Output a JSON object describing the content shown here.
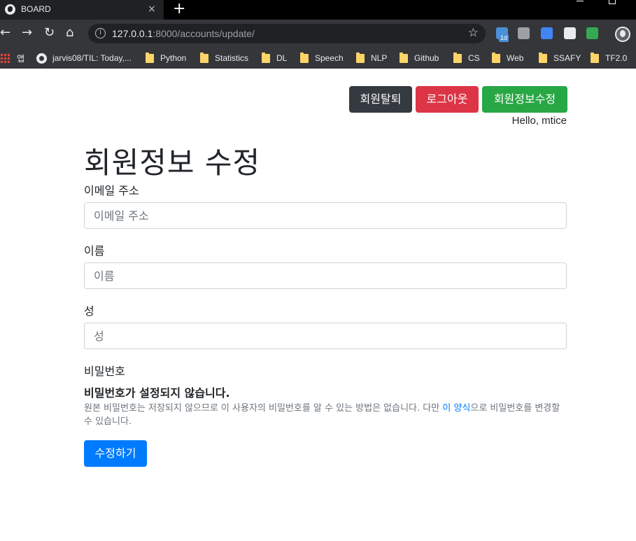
{
  "browser": {
    "tab_title": "BOARD",
    "tab_close": "×",
    "new_tab": "+",
    "url_host": "127.0.0.1",
    "url_path": ":8000/accounts/update/",
    "bookmarks": [
      {
        "label": "앱",
        "icon": "apps-icon"
      },
      {
        "label": "jarvis08/TIL: Today,...",
        "icon": "github-icon"
      },
      {
        "label": "Python",
        "icon": "folder-icon"
      },
      {
        "label": "Statistics",
        "icon": "folder-icon"
      },
      {
        "label": "DL",
        "icon": "folder-icon"
      },
      {
        "label": "Speech",
        "icon": "folder-icon"
      },
      {
        "label": "NLP",
        "icon": "folder-icon"
      },
      {
        "label": "Github",
        "icon": "folder-icon"
      },
      {
        "label": "CS",
        "icon": "folder-icon"
      },
      {
        "label": "Web",
        "icon": "folder-icon"
      },
      {
        "label": "SSAFY",
        "icon": "folder-icon"
      },
      {
        "label": "TF2.0",
        "icon": "folder-icon"
      }
    ],
    "ext_badge": "1d"
  },
  "nav": {
    "withdraw_label": "회원탈퇴",
    "logout_label": "로그아웃",
    "edit_profile_label": "회원정보수정",
    "greeting": "Hello, mtice"
  },
  "form": {
    "title": "회원정보 수정",
    "email_label": "이메일 주소",
    "email_placeholder": "이메일 주소",
    "first_name_label": "이름",
    "first_name_placeholder": "이름",
    "last_name_label": "성",
    "last_name_placeholder": "성",
    "password_label": "비밀번호",
    "password_status": "비밀번호가 설정되지 않습니다.",
    "password_help_before": "원본 비밀번호는 저장되지 않으므로 이 사용자의 비밀번호를 알 수 있는 방법은 없습니다. 다만 ",
    "password_help_link": "이 양식",
    "password_help_after": "으로 비밀번호를 변경할 수 있습니다.",
    "submit_label": "수정하기"
  },
  "colors": {
    "primary": "#007bff",
    "danger": "#dc3545",
    "success": "#28a745",
    "dark": "#343a40"
  }
}
